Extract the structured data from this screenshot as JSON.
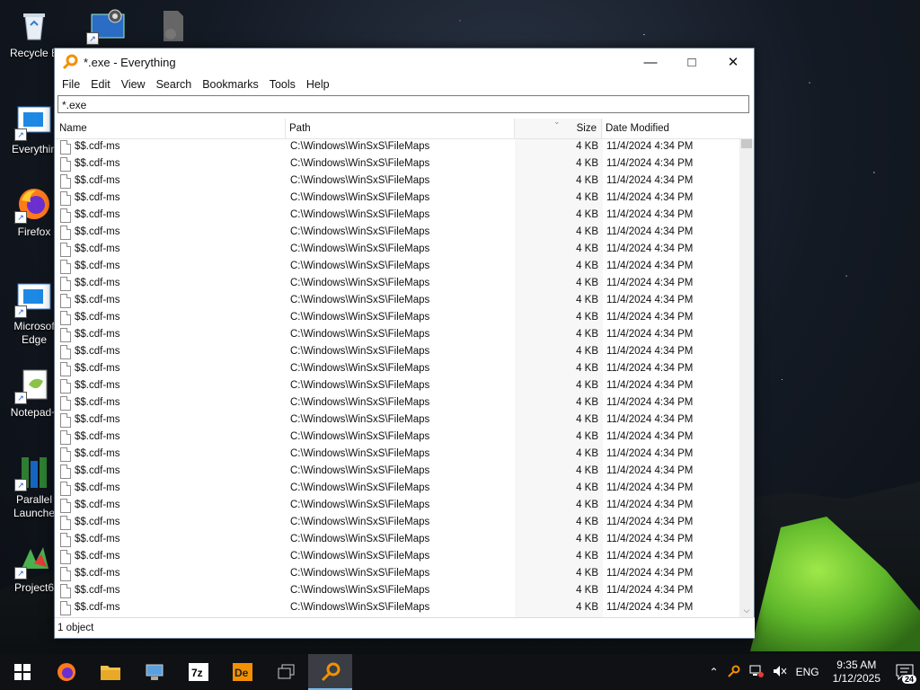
{
  "desktop": {
    "icons": [
      {
        "label": "Recycle B",
        "icon": "recycle-bin-icon"
      },
      {
        "label": "",
        "icon": "control-panel-icon"
      },
      {
        "label": "",
        "icon": "blank-file-icon"
      },
      {
        "label": "Everythin",
        "icon": "everything-shortcut-icon"
      },
      {
        "label": "Firefox",
        "icon": "firefox-icon"
      },
      {
        "label": "Microsof Edge",
        "icon": "edge-icon"
      },
      {
        "label": "Notepad+",
        "icon": "notepadpp-icon"
      },
      {
        "label": "Parallel Launche",
        "icon": "parallel-launcher-icon"
      },
      {
        "label": "Project6",
        "icon": "project64-icon"
      }
    ]
  },
  "window": {
    "title": "*.exe - Everything",
    "menu": [
      "File",
      "Edit",
      "View",
      "Search",
      "Bookmarks",
      "Tools",
      "Help"
    ],
    "search_value": "*.exe",
    "columns": {
      "name": "Name",
      "path": "Path",
      "size": "Size",
      "date": "Date Modified"
    },
    "rows": [
      {
        "name": "$$.cdf-ms",
        "path": "C:\\Windows\\WinSxS\\FileMaps",
        "size": "4 KB",
        "date": "11/4/2024 4:34 PM"
      },
      {
        "name": "$$.cdf-ms",
        "path": "C:\\Windows\\WinSxS\\FileMaps",
        "size": "4 KB",
        "date": "11/4/2024 4:34 PM"
      },
      {
        "name": "$$.cdf-ms",
        "path": "C:\\Windows\\WinSxS\\FileMaps",
        "size": "4 KB",
        "date": "11/4/2024 4:34 PM"
      },
      {
        "name": "$$.cdf-ms",
        "path": "C:\\Windows\\WinSxS\\FileMaps",
        "size": "4 KB",
        "date": "11/4/2024 4:34 PM"
      },
      {
        "name": "$$.cdf-ms",
        "path": "C:\\Windows\\WinSxS\\FileMaps",
        "size": "4 KB",
        "date": "11/4/2024 4:34 PM"
      },
      {
        "name": "$$.cdf-ms",
        "path": "C:\\Windows\\WinSxS\\FileMaps",
        "size": "4 KB",
        "date": "11/4/2024 4:34 PM"
      },
      {
        "name": "$$.cdf-ms",
        "path": "C:\\Windows\\WinSxS\\FileMaps",
        "size": "4 KB",
        "date": "11/4/2024 4:34 PM"
      },
      {
        "name": "$$.cdf-ms",
        "path": "C:\\Windows\\WinSxS\\FileMaps",
        "size": "4 KB",
        "date": "11/4/2024 4:34 PM"
      },
      {
        "name": "$$.cdf-ms",
        "path": "C:\\Windows\\WinSxS\\FileMaps",
        "size": "4 KB",
        "date": "11/4/2024 4:34 PM"
      },
      {
        "name": "$$.cdf-ms",
        "path": "C:\\Windows\\WinSxS\\FileMaps",
        "size": "4 KB",
        "date": "11/4/2024 4:34 PM"
      },
      {
        "name": "$$.cdf-ms",
        "path": "C:\\Windows\\WinSxS\\FileMaps",
        "size": "4 KB",
        "date": "11/4/2024 4:34 PM"
      },
      {
        "name": "$$.cdf-ms",
        "path": "C:\\Windows\\WinSxS\\FileMaps",
        "size": "4 KB",
        "date": "11/4/2024 4:34 PM"
      },
      {
        "name": "$$.cdf-ms",
        "path": "C:\\Windows\\WinSxS\\FileMaps",
        "size": "4 KB",
        "date": "11/4/2024 4:34 PM"
      },
      {
        "name": "$$.cdf-ms",
        "path": "C:\\Windows\\WinSxS\\FileMaps",
        "size": "4 KB",
        "date": "11/4/2024 4:34 PM"
      },
      {
        "name": "$$.cdf-ms",
        "path": "C:\\Windows\\WinSxS\\FileMaps",
        "size": "4 KB",
        "date": "11/4/2024 4:34 PM"
      },
      {
        "name": "$$.cdf-ms",
        "path": "C:\\Windows\\WinSxS\\FileMaps",
        "size": "4 KB",
        "date": "11/4/2024 4:34 PM"
      },
      {
        "name": "$$.cdf-ms",
        "path": "C:\\Windows\\WinSxS\\FileMaps",
        "size": "4 KB",
        "date": "11/4/2024 4:34 PM"
      },
      {
        "name": "$$.cdf-ms",
        "path": "C:\\Windows\\WinSxS\\FileMaps",
        "size": "4 KB",
        "date": "11/4/2024 4:34 PM"
      },
      {
        "name": "$$.cdf-ms",
        "path": "C:\\Windows\\WinSxS\\FileMaps",
        "size": "4 KB",
        "date": "11/4/2024 4:34 PM"
      },
      {
        "name": "$$.cdf-ms",
        "path": "C:\\Windows\\WinSxS\\FileMaps",
        "size": "4 KB",
        "date": "11/4/2024 4:34 PM"
      },
      {
        "name": "$$.cdf-ms",
        "path": "C:\\Windows\\WinSxS\\FileMaps",
        "size": "4 KB",
        "date": "11/4/2024 4:34 PM"
      },
      {
        "name": "$$.cdf-ms",
        "path": "C:\\Windows\\WinSxS\\FileMaps",
        "size": "4 KB",
        "date": "11/4/2024 4:34 PM"
      },
      {
        "name": "$$.cdf-ms",
        "path": "C:\\Windows\\WinSxS\\FileMaps",
        "size": "4 KB",
        "date": "11/4/2024 4:34 PM"
      },
      {
        "name": "$$.cdf-ms",
        "path": "C:\\Windows\\WinSxS\\FileMaps",
        "size": "4 KB",
        "date": "11/4/2024 4:34 PM"
      },
      {
        "name": "$$.cdf-ms",
        "path": "C:\\Windows\\WinSxS\\FileMaps",
        "size": "4 KB",
        "date": "11/4/2024 4:34 PM"
      },
      {
        "name": "$$.cdf-ms",
        "path": "C:\\Windows\\WinSxS\\FileMaps",
        "size": "4 KB",
        "date": "11/4/2024 4:34 PM"
      },
      {
        "name": "$$.cdf-ms",
        "path": "C:\\Windows\\WinSxS\\FileMaps",
        "size": "4 KB",
        "date": "11/4/2024 4:34 PM"
      },
      {
        "name": "$$.cdf-ms",
        "path": "C:\\Windows\\WinSxS\\FileMaps",
        "size": "4 KB",
        "date": "11/4/2024 4:34 PM"
      }
    ],
    "status": "1 object"
  },
  "taskbar": {
    "apps": [
      "start-icon",
      "firefox-icon",
      "file-explorer-icon",
      "network-icon",
      "7zip-icon",
      "dependencies-icon",
      "task-view-icon",
      "everything-icon"
    ],
    "tray": {
      "lang": "ENG",
      "time": "9:35 AM",
      "date": "1/12/2025",
      "notifications": "24"
    }
  },
  "colors": {
    "accent": "#f29100",
    "taskbar": "#101114",
    "selection_bar": "#76b9ed"
  }
}
